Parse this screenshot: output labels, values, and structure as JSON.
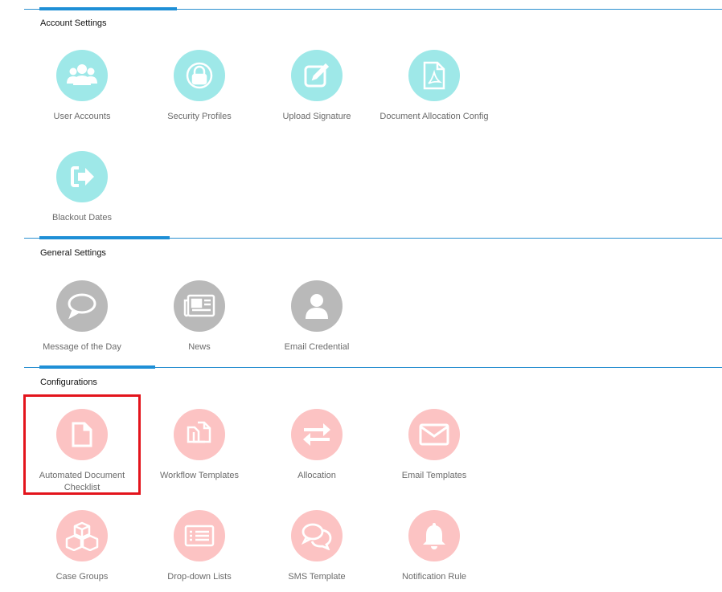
{
  "sections": {
    "account": {
      "title": "Account Settings",
      "items": [
        {
          "label": "User Accounts",
          "icon": "users-icon"
        },
        {
          "label": "Security Profiles",
          "icon": "lock-icon"
        },
        {
          "label": "Upload Signature",
          "icon": "edit-icon"
        },
        {
          "label": "Document Allocation Config",
          "icon": "pdf-file-icon"
        },
        {
          "label": "Blackout Dates",
          "icon": "sign-out-icon"
        }
      ]
    },
    "general": {
      "title": "General Settings",
      "items": [
        {
          "label": "Message of the Day",
          "icon": "speech-bubble-icon"
        },
        {
          "label": "News",
          "icon": "newspaper-icon"
        },
        {
          "label": "Email Credential",
          "icon": "person-icon"
        }
      ]
    },
    "config": {
      "title": "Configurations",
      "items": [
        {
          "label": "Automated Document Checklist",
          "icon": "document-icon"
        },
        {
          "label": "Workflow Templates",
          "icon": "copy-files-icon"
        },
        {
          "label": "Allocation",
          "icon": "exchange-arrows-icon"
        },
        {
          "label": "Email Templates",
          "icon": "envelope-icon"
        },
        {
          "label": "Case Groups",
          "icon": "cubes-icon"
        },
        {
          "label": "Drop-down Lists",
          "icon": "list-icon"
        },
        {
          "label": "SMS Template",
          "icon": "chat-bubbles-icon"
        },
        {
          "label": "Notification Rule",
          "icon": "bell-icon"
        }
      ]
    }
  },
  "colors": {
    "account_icon_bg": "#9ee8e8",
    "general_icon_bg": "#b9b9b9",
    "config_icon_bg": "#fcc3c3",
    "section_rule": "#2a90d0",
    "highlight_border": "#e3141c"
  }
}
